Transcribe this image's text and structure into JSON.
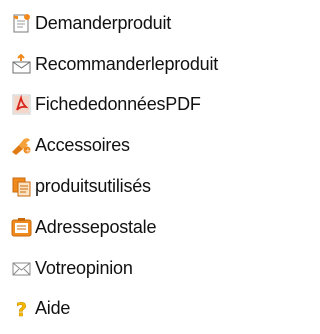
{
  "menu": {
    "items": [
      {
        "label": "Demanderproduit",
        "icon": "request-product-icon"
      },
      {
        "label": "Recommanderleproduit",
        "icon": "recommend-envelope-icon"
      },
      {
        "label": "FichededonnéesPDF",
        "icon": "pdf-icon"
      },
      {
        "label": "Accessoires",
        "icon": "accessories-icon"
      },
      {
        "label": "produitsutilisés",
        "icon": "used-products-icon"
      },
      {
        "label": "Adressepostale",
        "icon": "postal-address-icon"
      },
      {
        "label": "Votreopinion",
        "icon": "feedback-envelope-icon"
      },
      {
        "label": "Aide",
        "icon": "help-icon"
      }
    ]
  },
  "colors": {
    "text": "#111111",
    "accent_orange": "#f08a1c",
    "pdf_red": "#d8261c",
    "help_yellow": "#f5b800"
  }
}
